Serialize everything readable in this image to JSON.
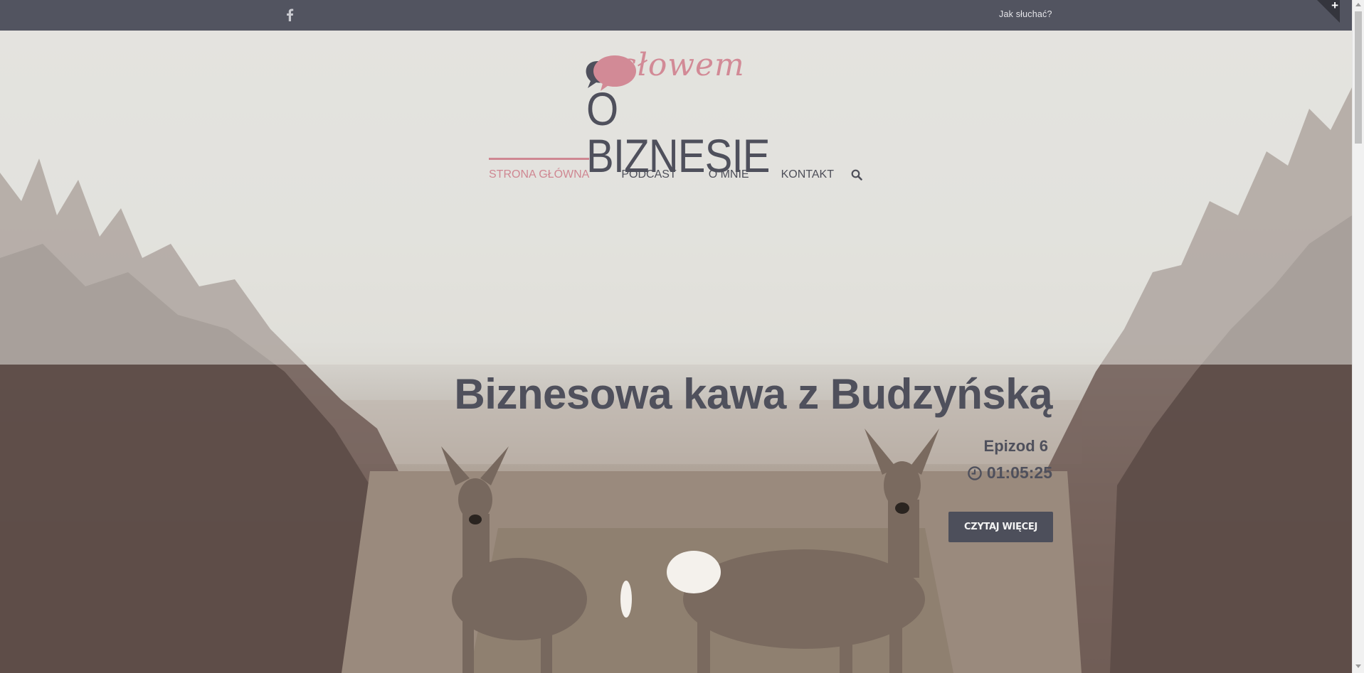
{
  "topbar": {
    "social": "facebook-icon",
    "link_label": "Jak słuchać?",
    "toggle_symbol": "+"
  },
  "logo": {
    "script_text": "słowem",
    "main_text": "O BIZNESIE",
    "bubble_color": "#d28a96",
    "text_color": "#4f505c"
  },
  "nav": {
    "items": [
      {
        "label": "STRONA GŁÓWNA",
        "active": true
      },
      {
        "label": "PODCAST",
        "active": false
      },
      {
        "label": "O MNIE",
        "active": false
      },
      {
        "label": "KONTAKT",
        "active": false
      }
    ],
    "search": "search-icon",
    "accent_color": "#cf8792"
  },
  "slide": {
    "title": "Biznesowa kawa z Budzyńską",
    "episode": "Epizod 6",
    "duration": "01:05:25",
    "button_label": "CZYTAJ WIĘCEJ"
  }
}
